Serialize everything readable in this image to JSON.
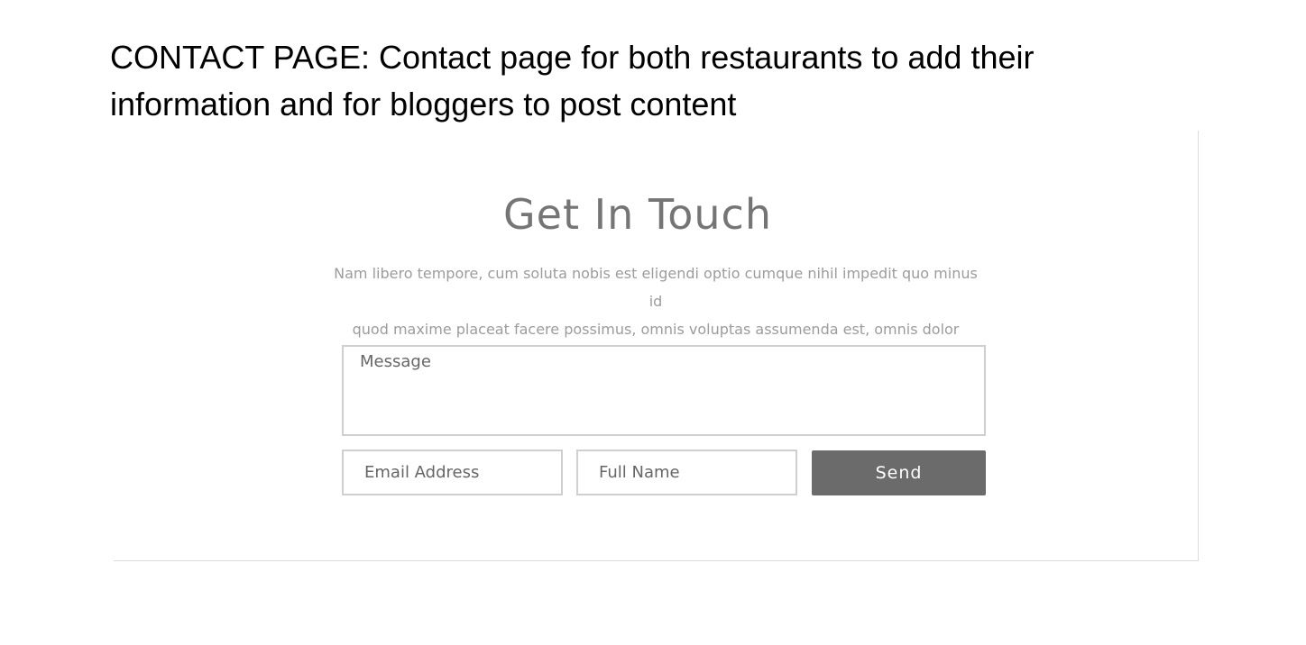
{
  "caption": "CONTACT PAGE: Contact page for both restaurants to add their information and for bloggers to post content",
  "contact": {
    "title": "Get In Touch",
    "description_line1": "Nam libero tempore, cum soluta nobis est eligendi optio cumque nihil impedit quo minus id",
    "description_line2": "quod maxime placeat facere possimus, omnis voluptas assumenda est, omnis dolor",
    "message_placeholder": "Message",
    "email_placeholder": "Email Address",
    "name_placeholder": "Full Name",
    "send_label": "Send"
  }
}
